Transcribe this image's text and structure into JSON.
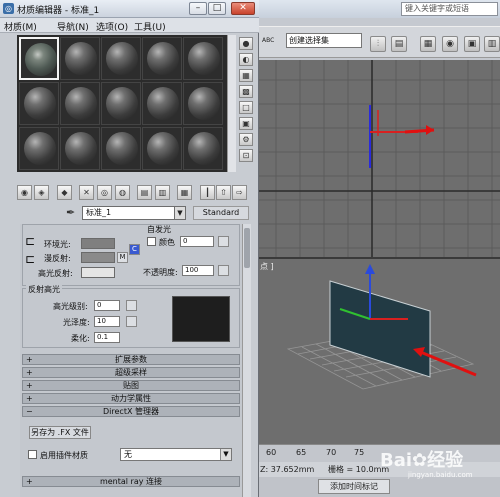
{
  "max_app": {
    "search_placeholder": "键入关键字或短语",
    "selection_set_dropdown": "创建选择集",
    "toolbar_abc_label": "ABC",
    "top_viewport_label": "",
    "persp_viewport_label": "点 ]",
    "timeline_ticks": [
      "60",
      "65",
      "70",
      "75"
    ],
    "coord": {
      "z": "Z: 37.652mm",
      "grid": "栅格 = 10.0mm"
    },
    "add_time_tag": "添加时间标记"
  },
  "material_editor": {
    "title": "材质编辑器 - 标准_1",
    "menu": [
      "材质(M)",
      "导航(N)",
      "选项(O)",
      "工具(U)"
    ],
    "material_name": "标准_1",
    "material_type": "Standard",
    "self_illum": {
      "title": "自发光",
      "color_label": "颜色",
      "value": "0"
    },
    "basic": {
      "ambient_label": "环境光:",
      "diffuse_label": "漫反射:",
      "specular_label": "高光反射:",
      "map_button": "M",
      "lock_button": "C",
      "opacity_label": "不透明度:",
      "opacity_value": "100",
      "colors": {
        "ambient": "#7f7f7f",
        "diffuse": "#8a8a8a",
        "specular": "#e5e5e5"
      }
    },
    "specular_highlights": {
      "title": "反射高光",
      "level_label": "高光级别:",
      "level_value": "0",
      "gloss_label": "光泽度:",
      "gloss_value": "10",
      "soften_label": "柔化:",
      "soften_value": "0.1"
    },
    "rollouts": [
      "扩展参数",
      "超级采样",
      "贴图",
      "动力学属性"
    ],
    "directx_rollout": "DirectX 管理器",
    "save_fx_button": "另存为 .FX 文件",
    "enable_plugin_label": "启用插件材质",
    "plugin_value": "无",
    "mental_ray_rollout": "mental ray 连接"
  },
  "watermark": {
    "text": "Bai✿经验",
    "url": "jingyan.baidu.com"
  }
}
